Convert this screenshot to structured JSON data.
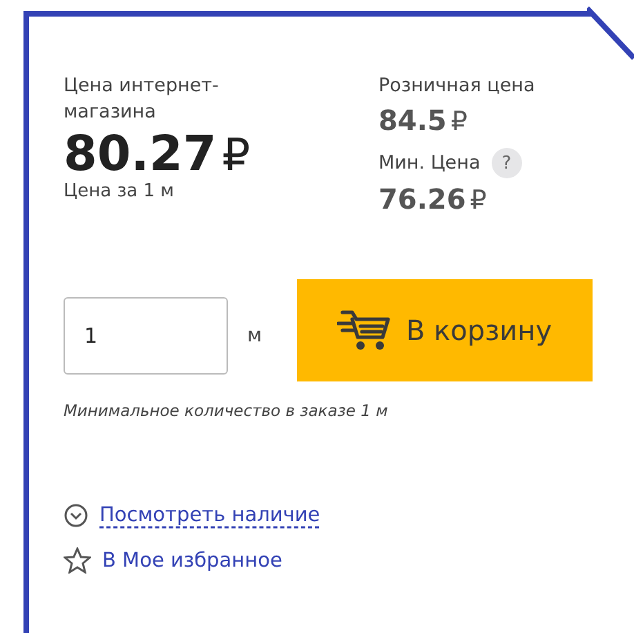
{
  "online_price": {
    "label": "Цена интернет-магазина",
    "value": "80.27",
    "currency": "₽",
    "note": "Цена за 1 м"
  },
  "retail_price": {
    "label": "Розничная цена",
    "value": "84.5",
    "currency": "₽"
  },
  "min_price": {
    "label": "Мин. Цена",
    "help": "?",
    "value": "76.26",
    "currency": "₽"
  },
  "quantity": {
    "value": "1",
    "unit": "м"
  },
  "cart_button": {
    "label": "В корзину"
  },
  "min_order_note": "Минимальное количество в заказе 1 м",
  "links": [
    {
      "kind": "availability",
      "label": "Посмотреть наличие"
    },
    {
      "kind": "favorite",
      "label": "В Мое избранное"
    }
  ]
}
